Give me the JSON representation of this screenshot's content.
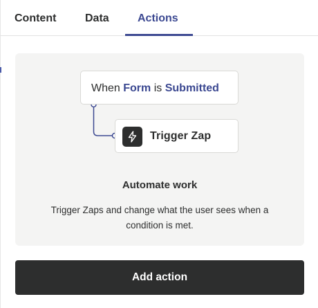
{
  "tabs": [
    {
      "label": "Content",
      "active": false
    },
    {
      "label": "Data",
      "active": false
    },
    {
      "label": "Actions",
      "active": true
    }
  ],
  "flow": {
    "trigger_prefix": "When",
    "trigger_object": "Form",
    "trigger_middle": "is",
    "trigger_event": "Submitted",
    "action_label": "Trigger Zap",
    "action_icon": "lightning-bolt-icon"
  },
  "card": {
    "title": "Automate work",
    "description": "Trigger Zaps and change what the user sees when a condition is met."
  },
  "add_action_label": "Add action",
  "colors": {
    "accent": "#3b4891",
    "dark": "#2d2e2e",
    "card_bg": "#f4f4f3"
  }
}
